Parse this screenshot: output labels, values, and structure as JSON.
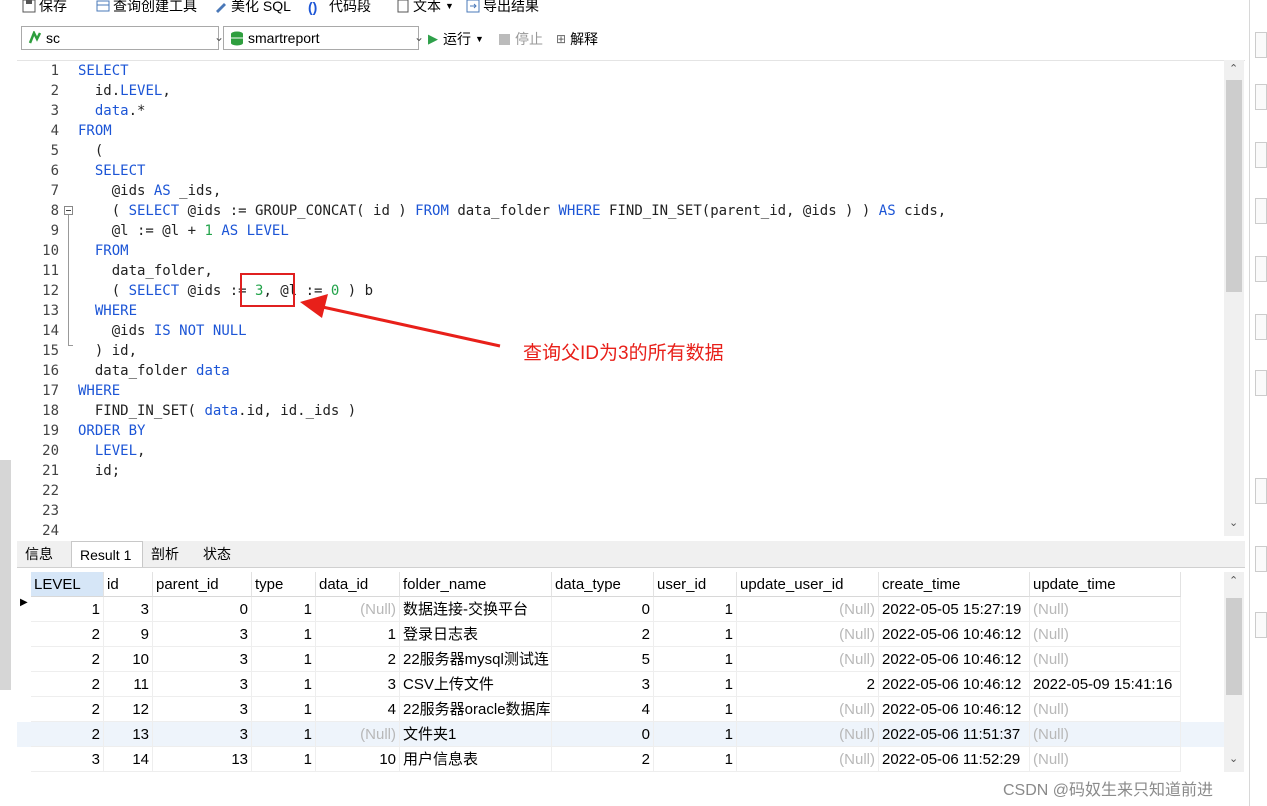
{
  "toolbar": {
    "save": "保存",
    "query_builder": "查询创建工具",
    "beautify_sql": "美化 SQL",
    "code_snippet": "代码段",
    "text": "文本",
    "export_result": "导出结果"
  },
  "connection": {
    "value": "sc"
  },
  "database": {
    "value": "smartreport"
  },
  "actions": {
    "run": "运行",
    "stop": "停止",
    "explain": "解释"
  },
  "editor": {
    "line_numbers": [
      "1",
      "2",
      "3",
      "4",
      "5",
      "6",
      "7",
      "8",
      "9",
      "10",
      "11",
      "12",
      "13",
      "14",
      "15",
      "16",
      "17",
      "18",
      "19",
      "20",
      "21",
      "22",
      "23",
      "24"
    ]
  },
  "annotation": {
    "text": "查询父ID为3的所有数据"
  },
  "tabs": [
    "信息",
    "Result 1",
    "剖析",
    "状态"
  ],
  "result": {
    "columns": [
      "LEVEL",
      "id",
      "parent_id",
      "type",
      "data_id",
      "folder_name",
      "data_type",
      "user_id",
      "update_user_id",
      "create_time",
      "update_time"
    ],
    "rows": [
      [
        "1",
        "3",
        "0",
        "1",
        "(Null)",
        "数据连接-交换平台",
        "0",
        "1",
        "(Null)",
        "2022-05-05 15:27:19",
        "(Null)"
      ],
      [
        "2",
        "9",
        "3",
        "1",
        "1",
        "登录日志表",
        "2",
        "1",
        "(Null)",
        "2022-05-06 10:46:12",
        "(Null)"
      ],
      [
        "2",
        "10",
        "3",
        "1",
        "2",
        "22服务器mysql测试连",
        "5",
        "1",
        "(Null)",
        "2022-05-06 10:46:12",
        "(Null)"
      ],
      [
        "2",
        "11",
        "3",
        "1",
        "3",
        "CSV上传文件",
        "3",
        "1",
        "2",
        "2022-05-06 10:46:12",
        "2022-05-09 15:41:16"
      ],
      [
        "2",
        "12",
        "3",
        "1",
        "4",
        "22服务器oracle数据库",
        "4",
        "1",
        "(Null)",
        "2022-05-06 10:46:12",
        "(Null)"
      ],
      [
        "2",
        "13",
        "3",
        "1",
        "(Null)",
        "文件夹1",
        "0",
        "1",
        "(Null)",
        "2022-05-06 11:51:37",
        "(Null)"
      ],
      [
        "3",
        "14",
        "13",
        "1",
        "10",
        "用户信息表",
        "2",
        "1",
        "(Null)",
        "2022-05-06 11:52:29",
        "(Null)"
      ]
    ]
  },
  "watermark": "CSDN @码奴生来只知道前进",
  "colors": {
    "keyword": "#1c55d6",
    "number": "#22a34a",
    "annotation": "#e8201a",
    "null": "#b8b8b8"
  }
}
